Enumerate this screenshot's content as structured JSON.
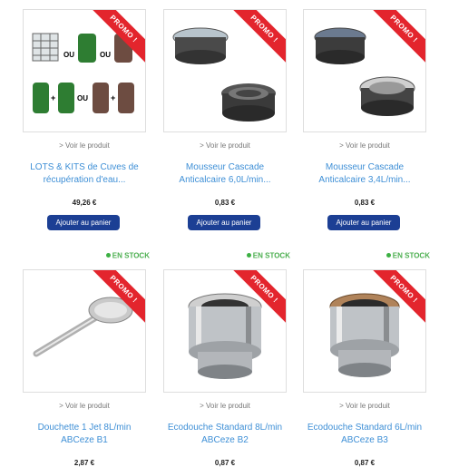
{
  "products": [
    {
      "promo": "PROMO !",
      "view": "> Voir le produit",
      "name1": "LOTS & KITS de Cuves de",
      "name2": "récupération d'eau...",
      "price": "49,26 €",
      "cart": "Ajouter au panier",
      "stock": "EN STOCK",
      "img_text": [
        "OU",
        "OU",
        "+",
        "OU",
        "+"
      ]
    },
    {
      "promo": "PROMO !",
      "view": "> Voir le produit",
      "name1": "Mousseur Cascade",
      "name2": "Anticalcaire 6,0L/min...",
      "price": "0,83 €",
      "cart": "Ajouter au panier",
      "stock": "EN STOCK"
    },
    {
      "promo": "PROMO !",
      "view": "> Voir le produit",
      "name1": "Mousseur Cascade",
      "name2": "Anticalcaire 3,4L/min...",
      "price": "0,83 €",
      "cart": "Ajouter au panier",
      "stock": "EN STOCK"
    },
    {
      "promo": "PROMO !",
      "view": "> Voir le produit",
      "name1": "Douchette 1 Jet 8L/min",
      "name2": "ABCeze B1",
      "price": "2,87 €"
    },
    {
      "promo": "PROMO !",
      "view": "> Voir le produit",
      "name1": "Ecodouche Standard 8L/min",
      "name2": "ABCeze B2",
      "price": "0,87 €"
    },
    {
      "promo": "PROMO !",
      "view": "> Voir le produit",
      "name1": "Ecodouche Standard 6L/min",
      "name2": "ABCeze B3",
      "price": "0,87 €"
    }
  ]
}
